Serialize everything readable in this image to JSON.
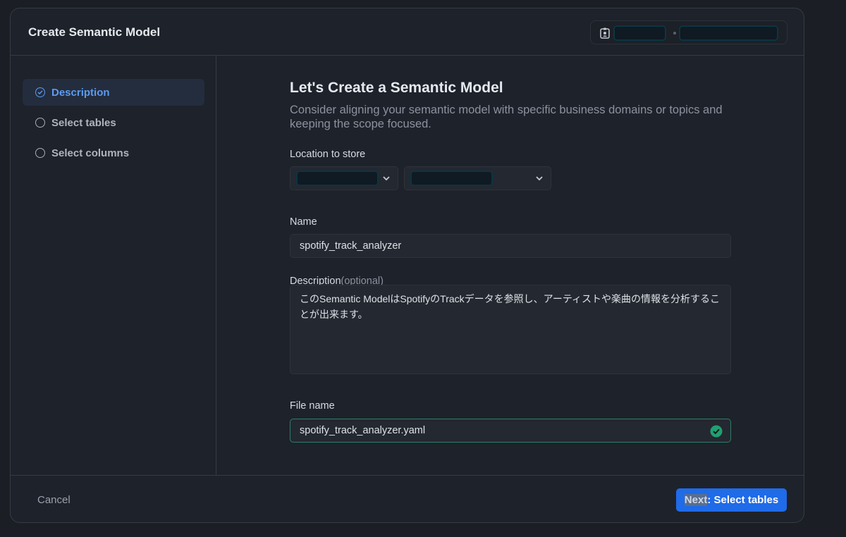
{
  "dialog": {
    "title": "Create Semantic Model"
  },
  "steps": [
    {
      "label": "Description",
      "active": true
    },
    {
      "label": "Select tables",
      "active": false
    },
    {
      "label": "Select columns",
      "active": false
    }
  ],
  "content": {
    "heading": "Let's Create a Semantic Model",
    "subheading": "Consider aligning your semantic model with specific business domains or topics and keeping the scope focused.",
    "location_label": "Location to store",
    "name_label": "Name",
    "name_value": "spotify_track_analyzer",
    "description_label": "Description",
    "description_optional": "(optional)",
    "description_value": "このSemantic ModelはSpotifyのTrackデータを参照し、アーティストや楽曲の情報を分析することが出来ます。",
    "filename_label": "File name",
    "filename_value": "spotify_track_analyzer.yaml"
  },
  "footer": {
    "cancel_label": "Cancel",
    "next_highlight": "Next",
    "next_rest": ": Select tables"
  },
  "colors": {
    "accent": "#1f6be8",
    "active_step": "#5d9af0",
    "success": "#1fa070"
  },
  "icons": {
    "context": "badge-icon",
    "step_complete": "check-circle-icon",
    "step_pending": "circle-icon",
    "dropdown": "chevron-down-icon",
    "valid": "check-circle-filled-icon"
  }
}
